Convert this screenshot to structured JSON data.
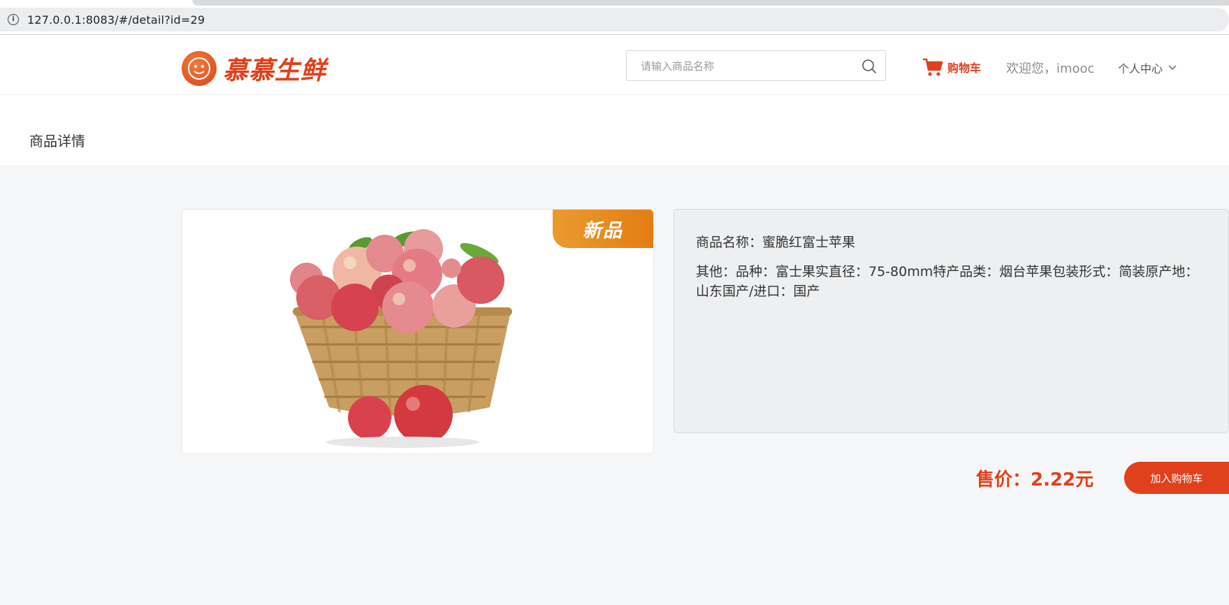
{
  "browser": {
    "url": "127.0.0.1:8083/#/detail?id=29"
  },
  "header": {
    "logo_text": "慕慕生鲜",
    "search_placeholder": "请输入商品名称",
    "cart_label": "购物车",
    "welcome_text": "欢迎您，imooc",
    "user_center_label": "个人中心"
  },
  "page": {
    "title": "商品详情"
  },
  "product": {
    "badge": "新品",
    "name_line": "商品名称：蜜脆红富士苹果",
    "other_line": "其他：品种：富士果实直径：75-80mm特产品类：烟台苹果包装形式：简装原产地：山东国产/进口：国产",
    "price_text": "售价：2.22元",
    "add_to_cart_label": "加入购物车"
  },
  "colors": {
    "accent": "#e0401b",
    "badge": "#e37d14",
    "page_bg": "#f5f6f8"
  },
  "icons": {
    "address": "info-icon",
    "search": "search-icon",
    "cart": "cart-icon",
    "dropdown": "chevron-down-icon"
  }
}
